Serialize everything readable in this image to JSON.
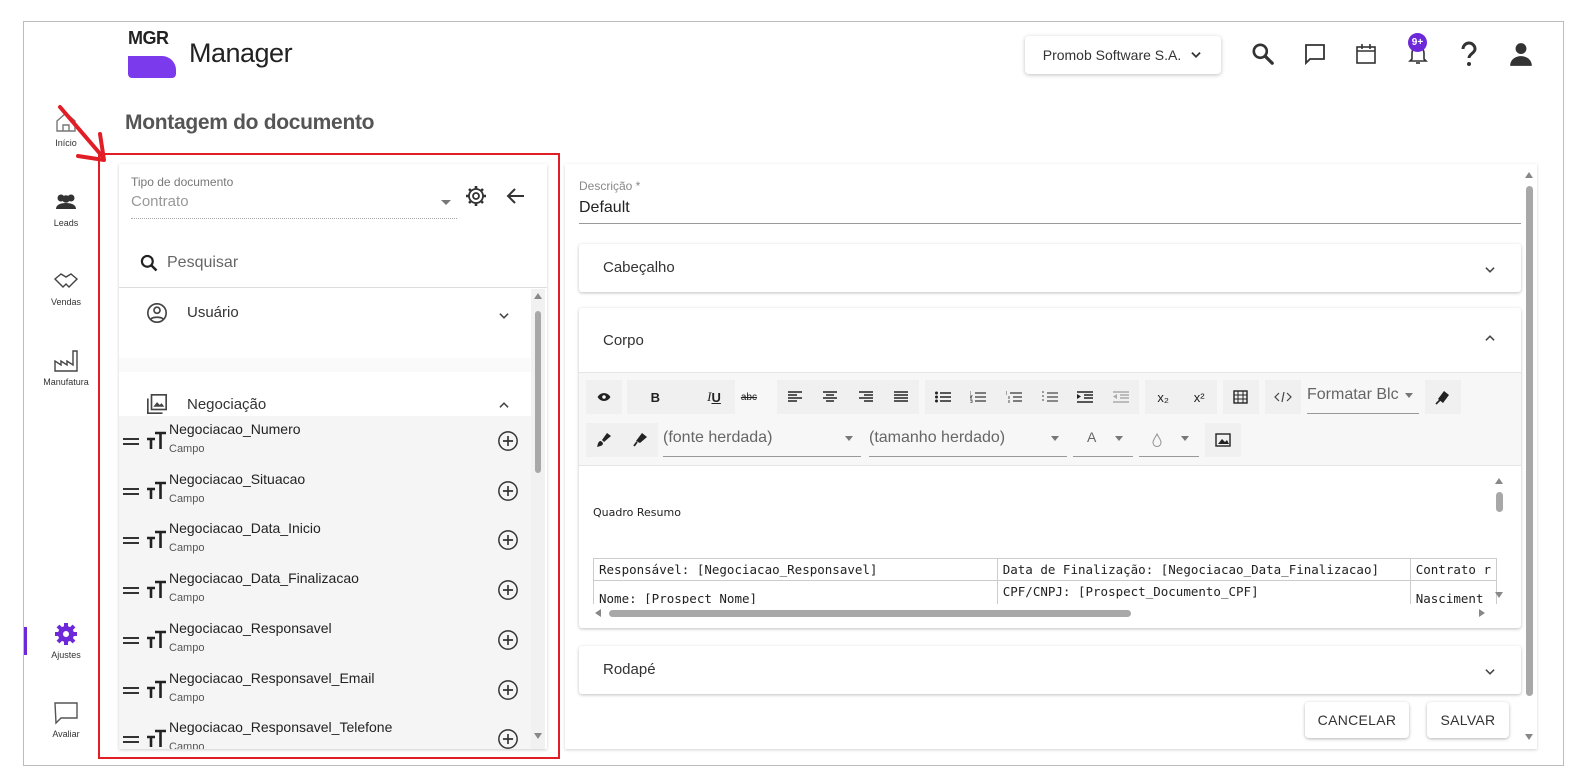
{
  "header": {
    "logo_text": "MGR",
    "app_title": "Manager",
    "company": "Promob Software S.A.",
    "notifications_badge": "9+"
  },
  "nav": {
    "items": [
      {
        "label": "Início"
      },
      {
        "label": "Leads"
      },
      {
        "label": "Vendas"
      },
      {
        "label": "Manufatura"
      },
      {
        "label": "Ajustes"
      },
      {
        "label": "Avaliar"
      }
    ]
  },
  "page_title": "Montagem do documento",
  "left_panel": {
    "tipo_label": "Tipo de documento",
    "tipo_value": "Contrato",
    "search_placeholder": "Pesquisar",
    "sections": [
      {
        "label": "Usuário",
        "expanded": false
      },
      {
        "label": "Negociação",
        "expanded": true
      }
    ],
    "fields": [
      {
        "name": "Negociacao_Numero",
        "type": "Campo"
      },
      {
        "name": "Negociacao_Situacao",
        "type": "Campo"
      },
      {
        "name": "Negociacao_Data_Inicio",
        "type": "Campo"
      },
      {
        "name": "Negociacao_Data_Finalizacao",
        "type": "Campo"
      },
      {
        "name": "Negociacao_Responsavel",
        "type": "Campo"
      },
      {
        "name": "Negociacao_Responsavel_Email",
        "type": "Campo"
      },
      {
        "name": "Negociacao_Responsavel_Telefone",
        "type": "Campo"
      }
    ]
  },
  "right_panel": {
    "desc_label": "Descrição *",
    "desc_value": "Default",
    "sections": {
      "cabecalho": "Cabeçalho",
      "corpo": "Corpo",
      "rodape": "Rodapé"
    },
    "toolbar": {
      "bold": "B",
      "italic": "I",
      "underline": "U",
      "strike": "abc",
      "subscript": "x₂",
      "superscript": "x²",
      "format_block": "Formatar Blc",
      "font": "(fonte herdada)",
      "size": "(tamanho herdado)",
      "font_color": "A"
    },
    "editor": {
      "heading": "Quadro Resumo",
      "row1": [
        "Responsável: [Negociacao_Responsavel]",
        "Data de Finalização: [Negociacao_Data_Finalizacao]",
        "Contrato r"
      ],
      "row2": [
        "Nome: [Prospect_Nome]",
        "CPF/CNPJ: [Prospect_Documento_CPF]",
        "Nasciment"
      ]
    },
    "buttons": {
      "cancel": "CANCELAR",
      "save": "SALVAR"
    }
  }
}
